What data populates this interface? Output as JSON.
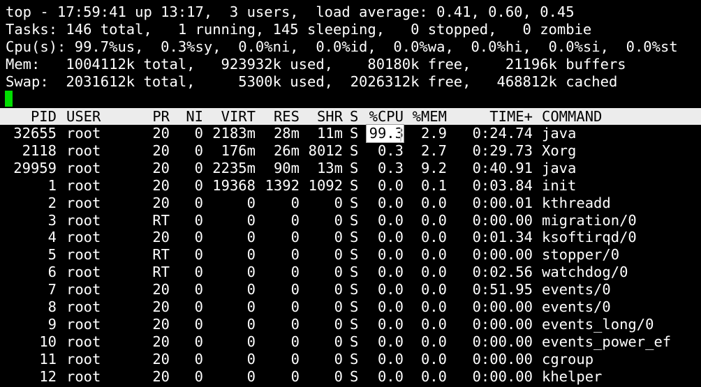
{
  "summary": {
    "line1": "top - 17:59:41 up 13:17,  3 users,  load average: 0.41, 0.60, 0.45",
    "line2": "Tasks: 146 total,   1 running, 145 sleeping,   0 stopped,   0 zombie",
    "line3": "Cpu(s): 99.7%us,  0.3%sy,  0.0%ni,  0.0%id,  0.0%wa,  0.0%hi,  0.0%si,  0.0%st",
    "line4": "Mem:   1004112k total,   923932k used,    80180k free,    21196k buffers",
    "line5": "Swap:  2031612k total,     5300k used,  2026312k free,   468812k cached"
  },
  "colors": {
    "background": "#000000",
    "text": "#ffffff",
    "header_bar": "#ececec",
    "cursor": "#00dd00"
  },
  "table": {
    "columns": [
      "PID",
      "USER",
      "PR",
      "NI",
      "VIRT",
      "RES",
      "SHR",
      "S",
      "%CPU",
      "%MEM",
      "TIME+",
      "COMMAND"
    ],
    "rows": [
      [
        "32655",
        "root",
        "20",
        "0",
        "2183m",
        "28m",
        "11m",
        "S",
        "99.3",
        "2.9",
        "0:24.74",
        "java"
      ],
      [
        "2118",
        "root",
        "20",
        "0",
        "176m",
        "26m",
        "8012",
        "S",
        "0.3",
        "2.7",
        "0:29.73",
        "Xorg"
      ],
      [
        "29959",
        "root",
        "20",
        "0",
        "2235m",
        "90m",
        "13m",
        "S",
        "0.3",
        "9.2",
        "0:40.91",
        "java"
      ],
      [
        "1",
        "root",
        "20",
        "0",
        "19368",
        "1392",
        "1092",
        "S",
        "0.0",
        "0.1",
        "0:03.84",
        "init"
      ],
      [
        "2",
        "root",
        "20",
        "0",
        "0",
        "0",
        "0",
        "S",
        "0.0",
        "0.0",
        "0:00.01",
        "kthreadd"
      ],
      [
        "3",
        "root",
        "RT",
        "0",
        "0",
        "0",
        "0",
        "S",
        "0.0",
        "0.0",
        "0:00.00",
        "migration/0"
      ],
      [
        "4",
        "root",
        "20",
        "0",
        "0",
        "0",
        "0",
        "S",
        "0.0",
        "0.0",
        "0:01.34",
        "ksoftirqd/0"
      ],
      [
        "5",
        "root",
        "RT",
        "0",
        "0",
        "0",
        "0",
        "S",
        "0.0",
        "0.0",
        "0:00.00",
        "stopper/0"
      ],
      [
        "6",
        "root",
        "RT",
        "0",
        "0",
        "0",
        "0",
        "S",
        "0.0",
        "0.0",
        "0:02.56",
        "watchdog/0"
      ],
      [
        "7",
        "root",
        "20",
        "0",
        "0",
        "0",
        "0",
        "S",
        "0.0",
        "0.0",
        "0:51.95",
        "events/0"
      ],
      [
        "8",
        "root",
        "20",
        "0",
        "0",
        "0",
        "0",
        "S",
        "0.0",
        "0.0",
        "0:00.00",
        "events/0"
      ],
      [
        "9",
        "root",
        "20",
        "0",
        "0",
        "0",
        "0",
        "S",
        "0.0",
        "0.0",
        "0:00.00",
        "events_long/0"
      ],
      [
        "10",
        "root",
        "20",
        "0",
        "0",
        "0",
        "0",
        "S",
        "0.0",
        "0.0",
        "0:00.00",
        "events_power_ef"
      ],
      [
        "11",
        "root",
        "20",
        "0",
        "0",
        "0",
        "0",
        "S",
        "0.0",
        "0.0",
        "0:00.00",
        "cgroup"
      ],
      [
        "12",
        "root",
        "20",
        "0",
        "0",
        "0",
        "0",
        "S",
        "0.0",
        "0.0",
        "0:00.00",
        "khelper"
      ]
    ]
  }
}
